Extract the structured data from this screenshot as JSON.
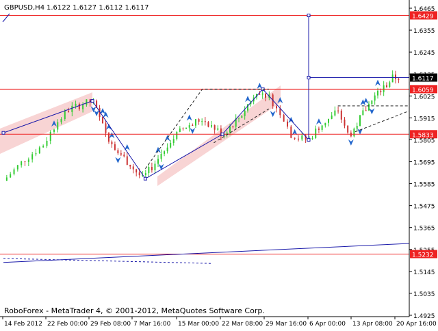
{
  "chart_data": {
    "type": "candlestick",
    "symbol_label": "GBPUSD,H4",
    "ohlc_label": "1.6122 1.6127 1.6112 1.6117",
    "watermark": "RoboForex - MetaTrader 4, © 2001-2012, MetaQuotes Software Corp.",
    "y_ticks": [
      "1.6465",
      "1.6355",
      "1.6245",
      "1.6135",
      "1.6025",
      "1.5915",
      "1.5805",
      "1.5695",
      "1.5585",
      "1.5475",
      "1.5365",
      "1.5255",
      "1.5145",
      "1.5035",
      "1.4925"
    ],
    "x_ticks": [
      "14 Feb 2012",
      "22 Feb 00:00",
      "29 Feb 08:00",
      "7 Mar 16:00",
      "15 Mar 00:00",
      "22 Mar 08:00",
      "29 Mar 16:00",
      "6 Apr 00:00",
      "13 Apr 08:00",
      "20 Apr 16:00"
    ],
    "ylim": [
      1.4925,
      1.6465
    ],
    "grid": false,
    "price_levels": [
      {
        "value": 1.6429,
        "label": "1.6429",
        "color": "#ee2222"
      },
      {
        "value": 1.6059,
        "label": "1.6059",
        "color": "#ee2222"
      },
      {
        "value": 1.5833,
        "label": "1.5833",
        "color": "#ee2222"
      },
      {
        "value": 1.5232,
        "label": "1.5232",
        "color": "#ee2222"
      }
    ],
    "current_price": {
      "value": 1.6117,
      "label": "1.6117"
    },
    "projection": [
      {
        "x": "14 Feb 2012",
        "y": 1.584
      },
      {
        "x": "29 Feb 08:00",
        "y": 1.6
      },
      {
        "x": "8 Mar",
        "y": 1.561
      },
      {
        "x": "22 Mar 08:00",
        "y": 1.5833
      },
      {
        "x": "30 Mar",
        "y": 1.6059
      },
      {
        "x": "5 Apr",
        "y": 1.5805
      },
      {
        "x": "5 Apr",
        "y": 1.6429
      }
    ],
    "colors": {
      "up": "#33cc33",
      "down": "#cc3333",
      "level": "#ee2222",
      "trend": "#1a1aaa",
      "channel": "#f5c6c6",
      "fractal": "#2266cc"
    }
  }
}
